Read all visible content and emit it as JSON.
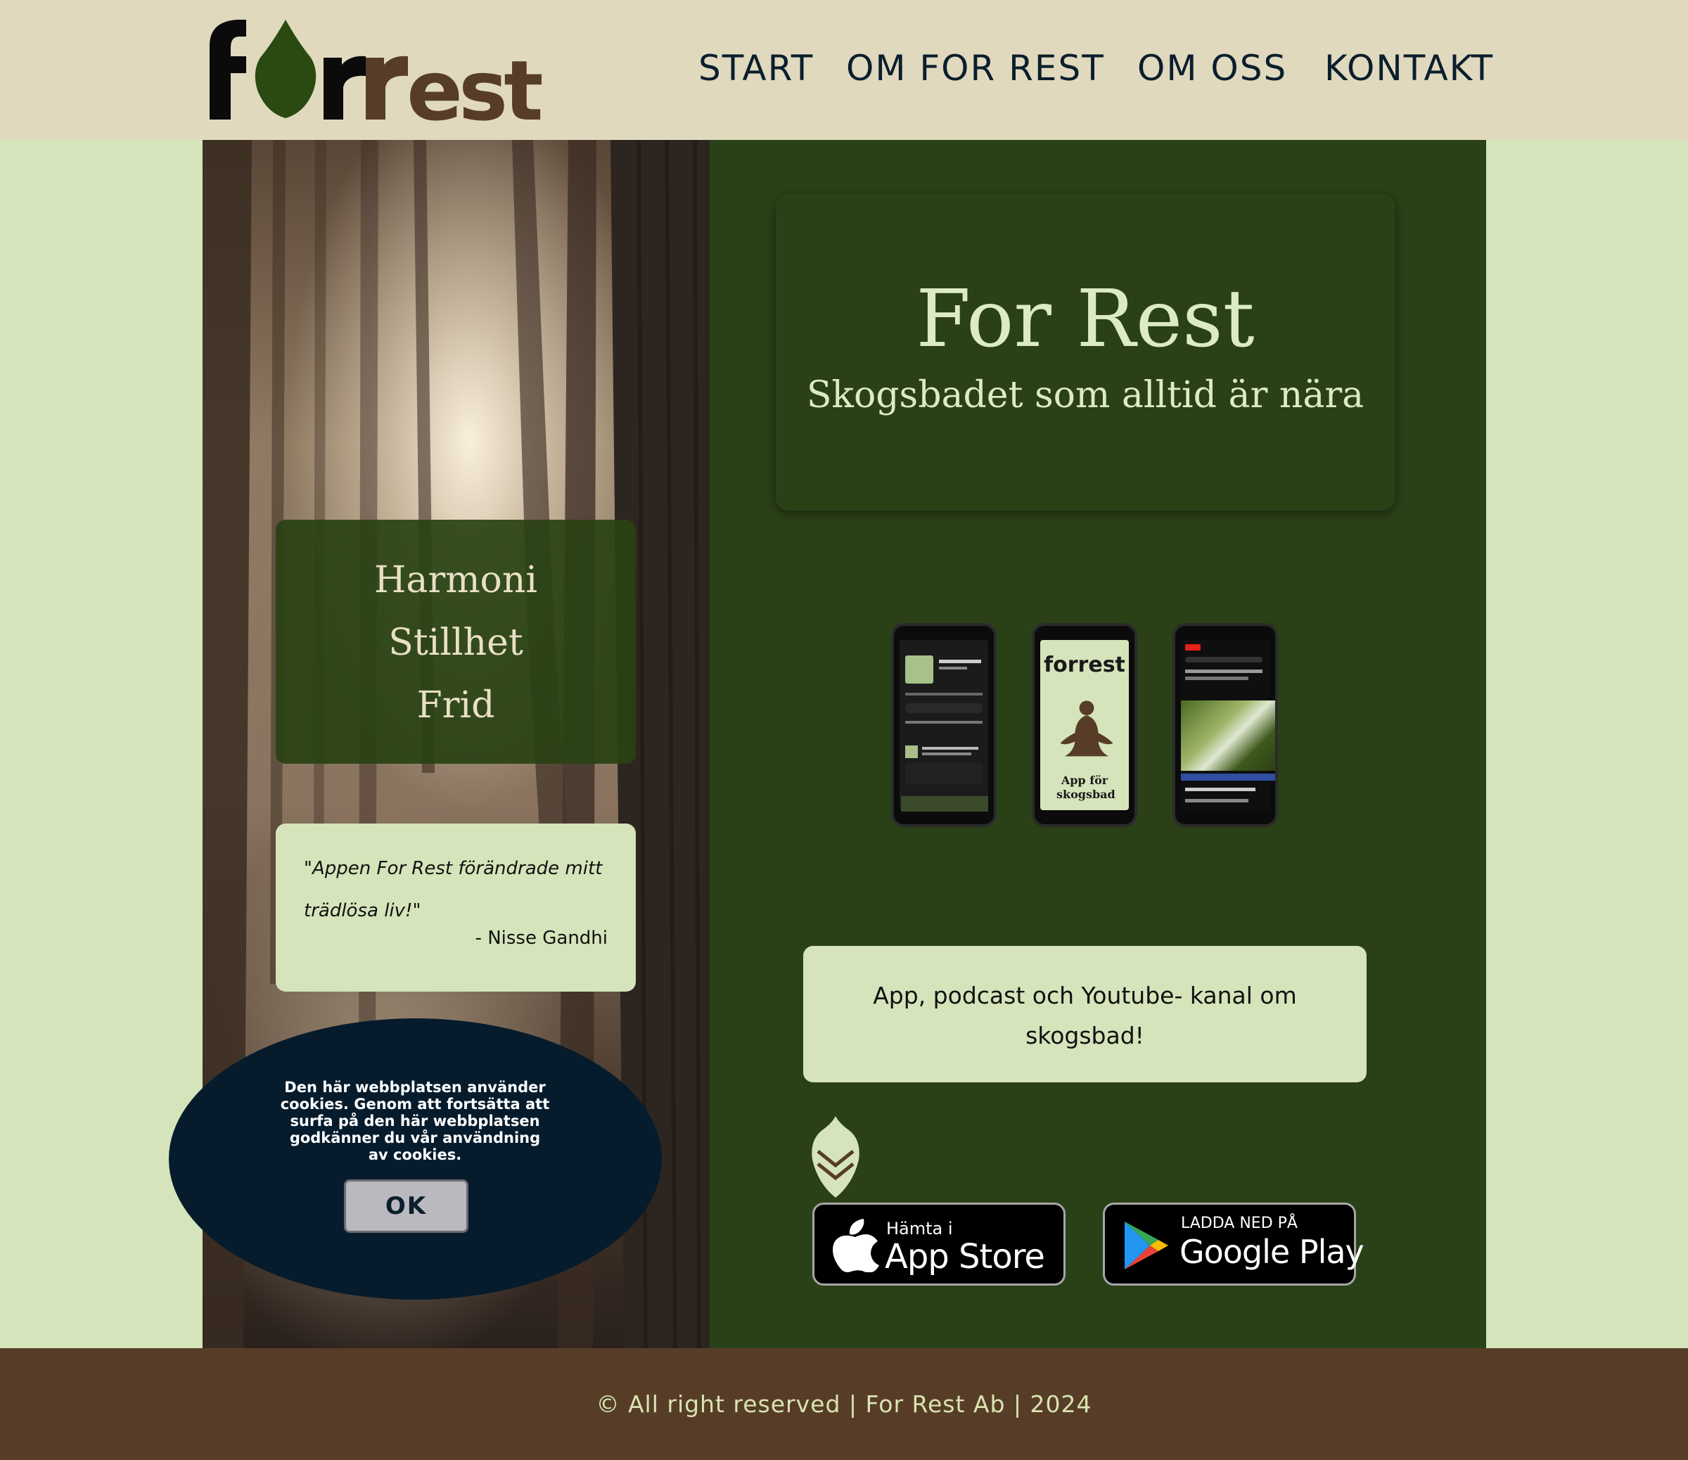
{
  "brand": {
    "logo_text": "forrest",
    "colors": {
      "leaf": "#2a4a12",
      "brown": "#573d28",
      "dark": "#0b0b0b"
    }
  },
  "nav": {
    "items": [
      {
        "label": "START"
      },
      {
        "label": "OM FOR REST"
      },
      {
        "label": "OM OSS"
      },
      {
        "label": "KONTAKT"
      }
    ]
  },
  "intro": {
    "words": [
      "Harmoni",
      "Stillhet",
      "Frid"
    ]
  },
  "testimonial": {
    "quote": "\"Appen For Rest förändrade mitt trädlösa liv!\"",
    "author": "- Nisse Gandhi"
  },
  "cookie": {
    "message": "Den här webbplatsen använder cookies. Genom att fortsätta att surfa på den här webbplatsen godkänner du vår användning av cookies.",
    "ok_label": "OK"
  },
  "hero": {
    "title": "For Rest",
    "subtitle": "Skogsbadet som alltid är nära"
  },
  "phones": {
    "app_caption": "App för skogsbad",
    "app_logo": "forrest"
  },
  "info": {
    "text": "App, podcast och Youtube- kanal om skogsbad!"
  },
  "stores": {
    "apple": {
      "small": "Hämta i",
      "big": "App Store",
      "icon": "apple-icon"
    },
    "google": {
      "small": "LADDA NED PÅ",
      "big": "Google Play",
      "icon": "google-play-icon"
    }
  },
  "footer": {
    "text": "© All right reserved | For Rest Ab | 2024"
  }
}
